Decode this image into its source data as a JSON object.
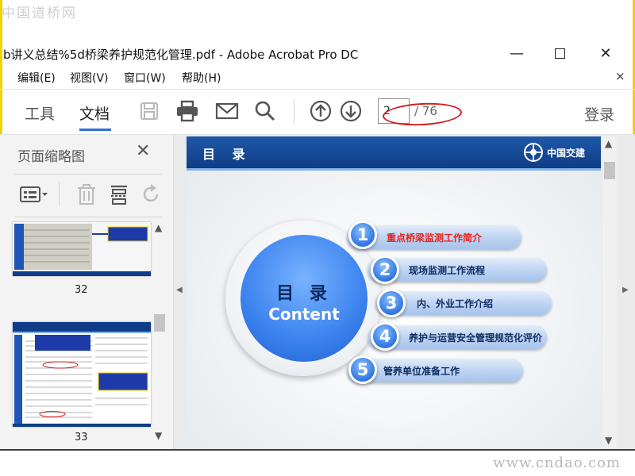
{
  "watermarks": {
    "top": "中国道桥网",
    "bottom": "www.cndao.com"
  },
  "window": {
    "title": "b讲义总结%5d桥梁养护规范化管理.pdf - Adobe Acrobat Pro DC",
    "close_glyph": "✕",
    "min_glyph": "—"
  },
  "menu": {
    "edit": "编辑(E)",
    "view": "视图(V)",
    "window": "窗口(W)",
    "help": "帮助(H)",
    "close_glyph": "×"
  },
  "toolbar": {
    "tab_tools": "工具",
    "tab_document": "文档",
    "page_current": "2",
    "page_total": "/ 76",
    "login": "登录",
    "icons": [
      "save-icon",
      "print-icon",
      "email-icon",
      "search-icon",
      "arrow-up-icon",
      "arrow-down-icon"
    ]
  },
  "left_panel": {
    "title": "页面缩略图",
    "close_glyph": "✕",
    "thumbnails": [
      {
        "label": "32"
      },
      {
        "label": "33"
      }
    ]
  },
  "slide": {
    "header_title": "目 录",
    "logo_text": "中国交建",
    "circle_title": "目 录",
    "circle_subtitle": "Content",
    "items": [
      {
        "num": "1",
        "text": "重点桥梁监测工作简介",
        "color": "#e8231c"
      },
      {
        "num": "2",
        "text": "现场监测工作流程",
        "color": "#0e2d63"
      },
      {
        "num": "3",
        "text": "内、外业工作介绍",
        "color": "#0e2d63"
      },
      {
        "num": "4",
        "text": "养护与运营安全管理规范化评价",
        "color": "#0e2d63"
      },
      {
        "num": "5",
        "text": "管养单位准备工作",
        "color": "#0e2d63"
      }
    ]
  },
  "colors": {
    "accent": "#2e6fd0",
    "annotation_red": "#d41c1c",
    "slide_header": "#1f58a8",
    "frame": "#f3d100"
  }
}
